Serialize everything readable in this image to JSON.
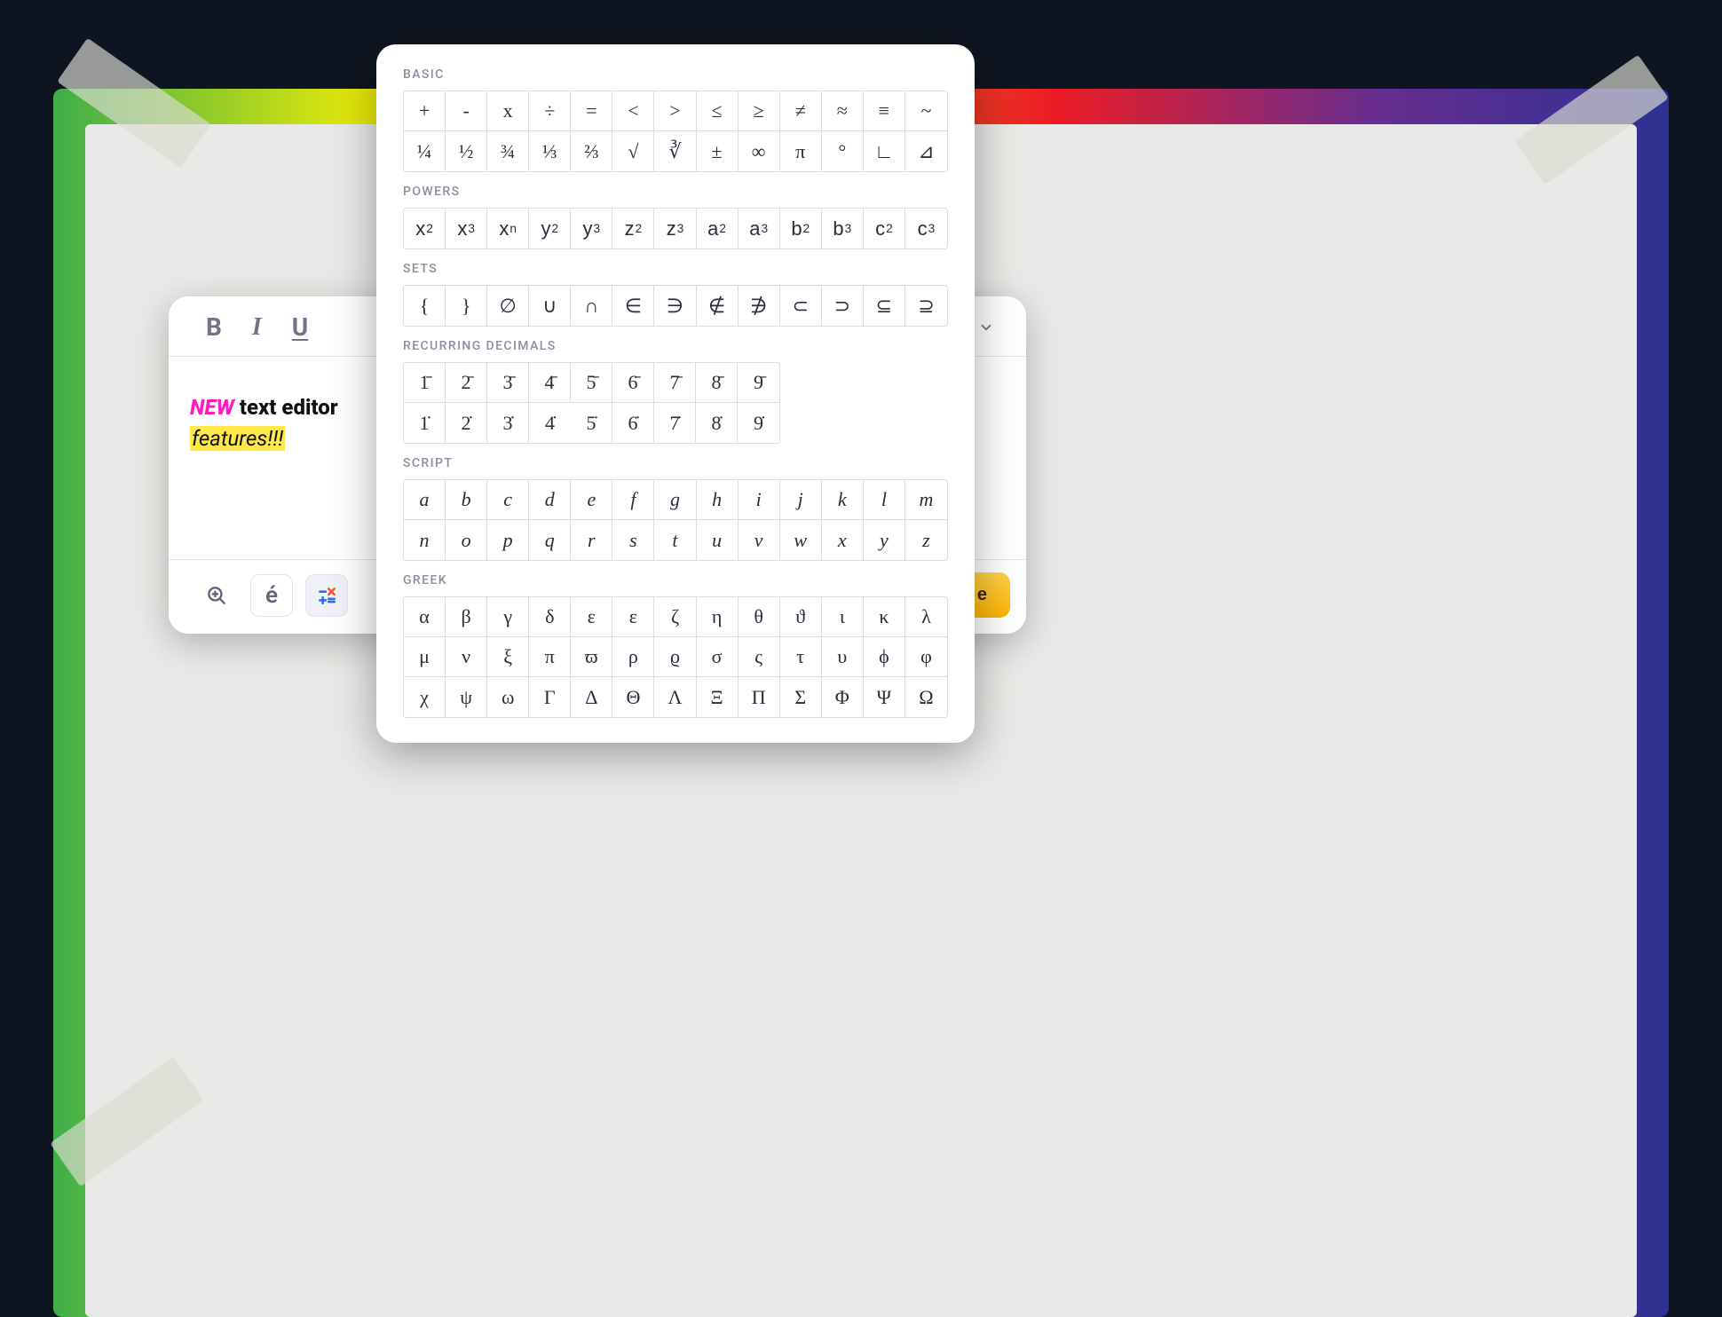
{
  "editor": {
    "toolbar": {
      "bold": "B",
      "italic": "I",
      "underline": "U"
    },
    "content": {
      "new_tag": "NEW",
      "bold_text": " text editor",
      "highlight_text": "features!!!"
    },
    "footer": {
      "accent_char": "é",
      "done_label": "e"
    }
  },
  "palette": {
    "sections": [
      {
        "id": "basic",
        "label": "BASIC",
        "cols": 13,
        "rows": [
          [
            "+",
            "-",
            "x",
            "÷",
            "=",
            "<",
            ">",
            "≤",
            "≥",
            "≠",
            "≈",
            "≡",
            "~"
          ],
          [
            "¼",
            "½",
            "¾",
            "⅓",
            "⅔",
            "√",
            "∛",
            "±",
            "∞",
            "π",
            "°",
            "∟",
            "⊿"
          ]
        ]
      },
      {
        "id": "powers",
        "label": "POWERS",
        "cols": 13,
        "rows": [
          [
            "x²",
            "x³",
            "xⁿ",
            "y²",
            "y³",
            "z²",
            "z³",
            "a²",
            "a³",
            "b²",
            "b³",
            "c²",
            "c³"
          ]
        ]
      },
      {
        "id": "sets",
        "label": "SETS",
        "cols": 13,
        "rows": [
          [
            "{",
            "}",
            "∅",
            "∪",
            "∩",
            "∈",
            "∋",
            "∉",
            "∌",
            "⊂",
            "⊃",
            "⊆",
            "⊇"
          ]
        ]
      },
      {
        "id": "recurring",
        "label": "RECURRING DECIMALS",
        "cols": 9,
        "rows": [
          [
            "1̄",
            "2̄",
            "3̄",
            "4̄",
            "5̄",
            "6̄",
            "7̄",
            "8̄",
            "9̄"
          ],
          [
            "1̇",
            "2̇",
            "3̇",
            "4̇",
            "5̇",
            "6̇",
            "7̇",
            "8̇",
            "9̇"
          ]
        ]
      },
      {
        "id": "script",
        "label": "SCRIPT",
        "cols": 13,
        "rows": [
          [
            "a",
            "b",
            "c",
            "d",
            "e",
            "f",
            "g",
            "h",
            "i",
            "j",
            "k",
            "l",
            "m"
          ],
          [
            "n",
            "o",
            "p",
            "q",
            "r",
            "s",
            "t",
            "u",
            "v",
            "w",
            "x",
            "y",
            "z"
          ]
        ]
      },
      {
        "id": "greek",
        "label": "GREEK",
        "cols": 13,
        "rows": [
          [
            "α",
            "β",
            "γ",
            "δ",
            "ε",
            "ɛ",
            "ζ",
            "η",
            "θ",
            "ϑ",
            "ι",
            "κ",
            "λ"
          ],
          [
            "μ",
            "ν",
            "ξ",
            "π",
            "ϖ",
            "ρ",
            "ϱ",
            "σ",
            "ς",
            "τ",
            "υ",
            "ϕ",
            "φ"
          ],
          [
            "χ",
            "ψ",
            "ω",
            "Γ",
            "Δ",
            "Θ",
            "Λ",
            "Ξ",
            "Π",
            "Σ",
            "Φ",
            "Ψ",
            "Ω"
          ]
        ]
      }
    ]
  }
}
